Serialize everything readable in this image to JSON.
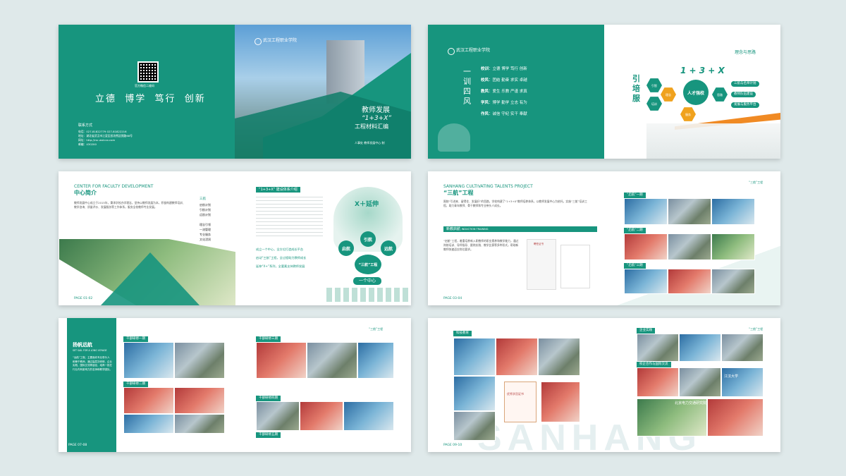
{
  "spread1": {
    "qr_caption": "官方微信二维码",
    "motto": "立德  博学  笃行  创新",
    "contact_title": "联系方式",
    "contact_lines": [
      "电话：027-81822779 027-81822216",
      "地址：湖北省武汉市江夏区纸坊熊廷弼路68号",
      "网址：http://rsc.wxlcxx.com",
      "邮编：430200"
    ],
    "logo_text": "武汉工程职业学院",
    "title_line1": "教师发展",
    "title_line2": "“1+3+X”",
    "title_line3": "工程材料汇编",
    "publisher": "人事处  教师发展中心  制"
  },
  "spread2": {
    "logo_text": "武汉工程职业学院",
    "calligraphy": "一训四风",
    "values": [
      {
        "label": "校训",
        "text": "立德 博学 笃行 创新"
      },
      {
        "label": "校风",
        "text": "团结 勤奋 求实 卓越"
      },
      {
        "label": "教风",
        "text": "爱生 乐教 严谨 求真"
      },
      {
        "label": "学风",
        "text": "博学 勤学 立志 有为"
      },
      {
        "label": "作风",
        "text": "诚信 守纪 实干 奉献"
      }
    ],
    "section_title": "理念与思路",
    "formula": "1 + 3 + X",
    "big_chars": "引 培 服",
    "center_text": "人才强校",
    "hexes": [
      "引智",
      "理念",
      "培训",
      "服务",
      "思路"
    ],
    "pills": [
      "三航与名师计划",
      "教师队伍建设",
      "发展与服务平台"
    ]
  },
  "spread3": {
    "en_title": "CENTER FOR FACULTY DEVELOPMENT",
    "cn_title": "中心简介",
    "body": "教师发展中心成立于2015年，秉承学校办学理念，坚持以教师发展为本，积极构建教师培训、教学咨询、质量评价、发展服务等工作体系，服务全校教师专业发展。",
    "list_title": "三航",
    "list_items": [
      "启航计划",
      "引航计划",
      "远航计划"
    ],
    "list2_items": [
      "理念引领",
      "一流管理",
      "专业服务",
      "文化浸润"
    ],
    "logo_text": "武汉工程职业学院",
    "page_label": "PAGE 01-02",
    "system_title": "“1+3+X” 建设体系介绍",
    "tree_title": "X＋延伸",
    "nodes": [
      "引航",
      "启航",
      "远航"
    ],
    "project_label": "“三航”工程",
    "center_label": "一个中心",
    "summary": "成立一个中心，全方位打造成长平台\n启动“三航”工程，全过程助力教师成长\n延伸“X+”系列，全要素支持教师发展"
  },
  "spread4": {
    "en_title": "SANHANG CULTIVATING TALENTS PROJECT",
    "cn_title": "“三航”工程",
    "body": "围绕“引进来、留得住、发展好”的思路，学校构建了“1+3+X”教师培养体系，以教师发展中心为依托，实施“三航”培训工程，助力青年教师、骨干教师和专业带头人成长。",
    "sub_title": "新教启航",
    "sub_en": "INDUCTION TRAINING",
    "sub_body": "“启航”工程，着重培养新入职教师的职业素养和教学能力，通过岗前培训、导师指导、跟岗实践、教学比赛等多种形式，帮助新教师快速适应岗位要求。",
    "doc_title": "聘任证书",
    "tags": [
      "“启航”一期",
      "“启航”二期",
      "“启航”三期"
    ],
    "page_label": "PAGE 03-04",
    "header_right": "“三航”工程"
  },
  "spread5": {
    "cn_title": "扬帆远航",
    "en_sub": "SET SAIL FOR A LONG VOYAGE",
    "body": "“远航”工程，主要面向专业带头人和骨干教师，通过高层次研修、企业实践、国际交流等途径，培养一批在行业内有影响力的名师和教学团队。",
    "tags": [
      "干部研修一期",
      "干部研修二期",
      "干部研修三期",
      "干部研修四期",
      "干部研修五期"
    ],
    "page_label": "PAGE 07-08",
    "header_right": "“三航”工程"
  },
  "spread6": {
    "tags": [
      "科技教育",
      "企业实践",
      "校企合作与国际交流"
    ],
    "certificate": "优秀学员证书",
    "banner1": "江汉大学",
    "banner2": "北京电力交通研究院",
    "watermark": "SANHANG",
    "page_label": "PAGE 09-10",
    "header_right": "“三航”工程"
  }
}
